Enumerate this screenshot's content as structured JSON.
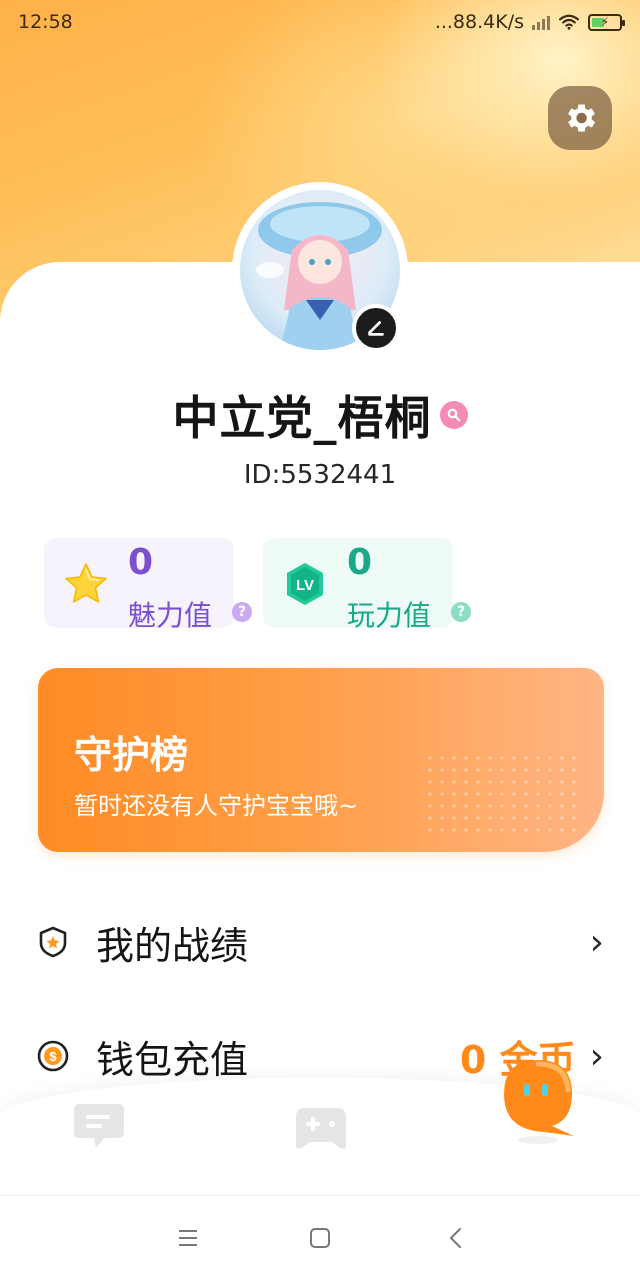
{
  "status_bar": {
    "time": "12:58",
    "network_speed": "...88.4K/s",
    "battery_icon": "battery-charging-icon",
    "wifi_icon": "wifi-icon"
  },
  "header": {
    "settings_icon": "gear-icon"
  },
  "profile": {
    "username": "中立党_梧桐",
    "id_text": "ID:5532441",
    "gender_icon": "female-icon",
    "edit_icon": "pencil-icon"
  },
  "stats": {
    "charm": {
      "value": "0",
      "label": "魅力值",
      "help": "?",
      "color": "#7b4fd0"
    },
    "play": {
      "value": "0",
      "label": "玩力值",
      "help": "?",
      "color": "#1aa889"
    }
  },
  "guard": {
    "title": "守护榜",
    "subtitle": "暂时还没有人守护宝宝哦~"
  },
  "menu": [
    {
      "label": "我的战绩",
      "icon": "shield-star-icon",
      "value": ""
    },
    {
      "label": "钱包充值",
      "icon": "coin-icon",
      "value": "0 金币"
    }
  ],
  "bottom_nav": [
    {
      "icon": "chat-icon",
      "active": false
    },
    {
      "icon": "gamepad-icon",
      "active": false
    },
    {
      "icon": "mascot-profile-icon",
      "active": true
    }
  ],
  "system_nav": [
    "menu-icon",
    "home-icon",
    "back-icon"
  ],
  "colors": {
    "accent_orange": "#ff8a1a",
    "charm_purple": "#7b4fd0",
    "play_green": "#1aa889"
  }
}
